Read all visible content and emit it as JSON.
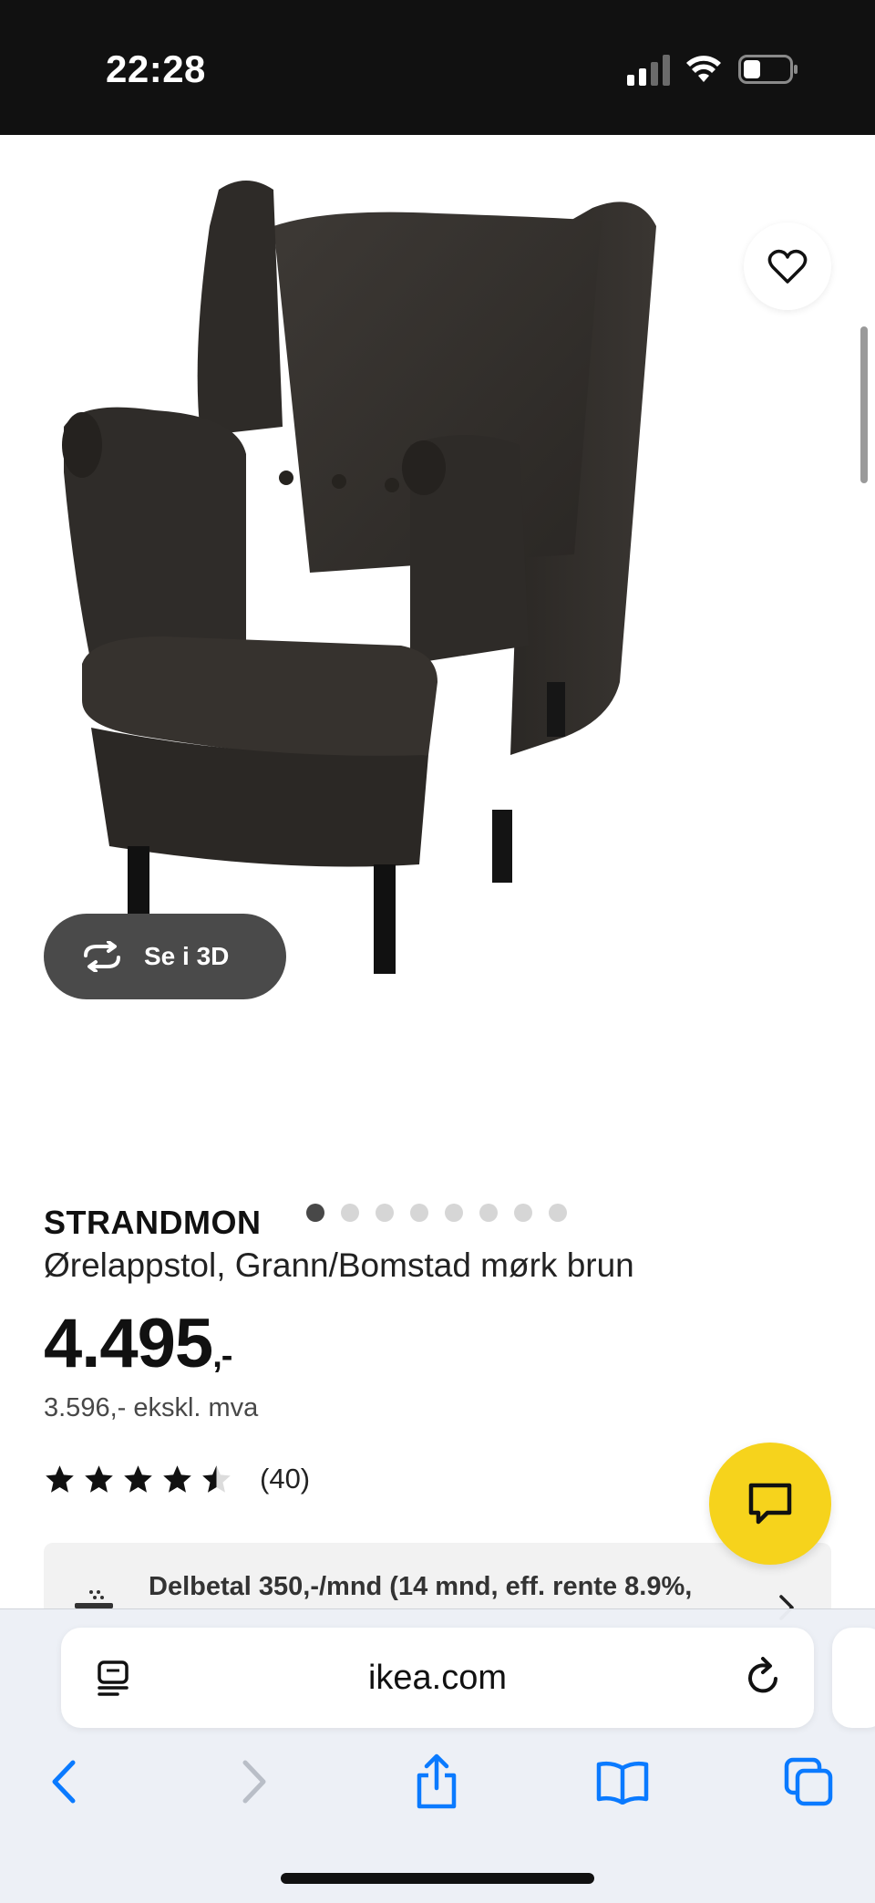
{
  "status_bar": {
    "time": "22:28",
    "icons": [
      "cellular-signal-icon",
      "wifi-icon",
      "battery-icon"
    ]
  },
  "gallery": {
    "image_alt": "STRANDMON armchair dark brown",
    "view_3d_label": "Se i 3D",
    "slide_count": 8,
    "active_slide": 1
  },
  "product": {
    "name": "STRANDMON",
    "description": "Ørelappstol, Grann/Bomstad mørk brun",
    "price": "4.495",
    "price_suffix": ",-",
    "price_ex_vat": "3.596,- ekskl. mva",
    "rating_value": 4.5,
    "rating_count": "(40)"
  },
  "finance": {
    "text": "Delbetal 350,-/mnd (14 mnd, eff. rente 8.9%,"
  },
  "browser": {
    "url": "ikea.com"
  },
  "colors": {
    "status_bar_bg": "#111111",
    "chat_button": "#f6d31c",
    "ios_blue": "#0a7aff",
    "chair_leather": "#33302c"
  }
}
